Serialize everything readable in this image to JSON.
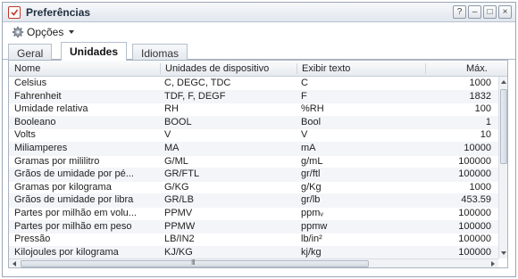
{
  "window": {
    "title": "Preferências",
    "controls": {
      "help": "?",
      "minimize": "–",
      "maximize": "□",
      "close": "×"
    }
  },
  "toolbar": {
    "options_label": "Opções",
    "options_icon": "gear-icon"
  },
  "tabs": [
    {
      "label": "Geral",
      "active": false
    },
    {
      "label": "Unidades",
      "active": true
    },
    {
      "label": "Idiomas",
      "active": false
    }
  ],
  "table": {
    "columns": [
      "Nome",
      "Unidades de dispositivo",
      "Exibir texto",
      "Máx."
    ],
    "rows": [
      [
        "Celsius",
        "C, DEGC, TDC",
        "C",
        "1000"
      ],
      [
        "Fahrenheit",
        "TDF, F, DEGF",
        "F",
        "1832"
      ],
      [
        "Umidade relativa",
        "RH",
        "%RH",
        "100"
      ],
      [
        "Booleano",
        "BOOL",
        "Bool",
        "1"
      ],
      [
        "Volts",
        "V",
        "V",
        "10"
      ],
      [
        "Miliamperes",
        "MA",
        "mA",
        "10000"
      ],
      [
        "Gramas por mililitro",
        "G/ML",
        "g/mL",
        "100000"
      ],
      [
        "Grãos de umidade por pé...",
        "GR/FTL",
        "gr/ftl",
        "100000"
      ],
      [
        "Gramas por kilograma",
        "G/KG",
        "g/Kg",
        "1000"
      ],
      [
        "Grãos de umidade por libra",
        "GR/LB",
        "gr/lb",
        "453.59"
      ],
      [
        "Partes por milhão em volu...",
        "PPMV",
        "ppmᵥ",
        "100000"
      ],
      [
        "Partes por milhão em peso",
        "PPMW",
        "ppmw",
        "100000"
      ],
      [
        "Pressão",
        "LB/IN2",
        "lb/in²",
        "100000"
      ],
      [
        "Kilojoules por kilograma",
        "KJ/KG",
        "kj/kg",
        "100000"
      ]
    ]
  },
  "colors": {
    "accent": "#c0392b",
    "header_bg": "#e2e7ee",
    "border": "#a9b4c2"
  }
}
